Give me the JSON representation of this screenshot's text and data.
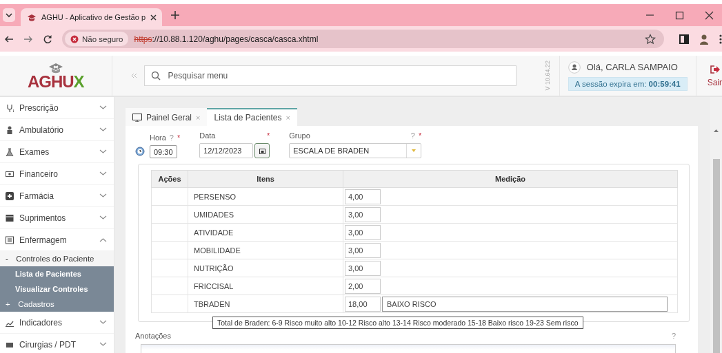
{
  "browser": {
    "tab_title": "AGHU - Aplicativo de Gestão p",
    "security_label": "Não seguro",
    "url_scheme": "https",
    "url_rest": "://10.88.1.120/aghu/pages/casca/casca.xhtml"
  },
  "header": {
    "logo_main": "AGHU",
    "logo_accent": "X",
    "search": {
      "placeholder": "Pesquisar menu"
    },
    "version": "V 10.64.22",
    "greeting": "Olá, CARLA SAMPAIO",
    "session_label": "A sessão expira em:",
    "session_time": "00:59:41",
    "logout": "Sair"
  },
  "sidebar": {
    "items": [
      {
        "label": "Prescrição",
        "expanded": false
      },
      {
        "label": "Ambulatório",
        "expanded": false
      },
      {
        "label": "Exames",
        "expanded": false
      },
      {
        "label": "Financeiro",
        "expanded": false
      },
      {
        "label": "Farmácia",
        "expanded": false
      },
      {
        "label": "Suprimentos",
        "expanded": false
      },
      {
        "label": "Enfermagem",
        "expanded": true,
        "children": [
          {
            "marker": "-",
            "label": "Controles do Paciente",
            "expanded": true,
            "children": [
              {
                "label": "Lista de Pacientes"
              },
              {
                "label": "Visualizar Controles"
              }
            ]
          },
          {
            "marker": "+",
            "label": "Cadastros",
            "expanded": false
          }
        ]
      },
      {
        "label": "Indicadores",
        "expanded": false
      },
      {
        "label": "Cirurgias / PDT",
        "expanded": false
      }
    ]
  },
  "tabs": [
    {
      "label": "Painel Geral",
      "close": "×",
      "selected": false
    },
    {
      "label": "Lista de Pacientes",
      "close": "×",
      "selected": true
    }
  ],
  "form": {
    "fields": [
      {
        "kind": "time",
        "label": "Hora",
        "help": "?",
        "required": "*",
        "value": "09:30"
      },
      {
        "kind": "date",
        "label": "Data",
        "required": "*",
        "value": "12/12/2023"
      },
      {
        "kind": "select",
        "label": "Grupo",
        "help": "?",
        "required": "*",
        "value": "ESCALA DE BRADEN"
      }
    ],
    "table": {
      "columns": [
        "Ações",
        "Itens",
        "Medição"
      ],
      "rows": [
        {
          "item": "PERSENSO",
          "value": "4,00"
        },
        {
          "item": "UMIDADES",
          "value": "3,00"
        },
        {
          "item": "ATIVIDADE",
          "value": "3,00"
        },
        {
          "item": "MOBILIDADE",
          "value": "3,00"
        },
        {
          "item": "NUTRIÇÃO",
          "value": "3,00"
        },
        {
          "item": "FRICCISAL",
          "value": "2,00"
        },
        {
          "item": "TBRADEN",
          "value": "18,00",
          "note": "BAIXO RISCO"
        }
      ]
    },
    "tooltip": "Total de Braden: 6-9 Risco muito alto 10-12 Risco alto 13-14 Risco moderado 15-18 Baixo risco 19-23 Sem risco",
    "notes_label": "Anotações",
    "notes_help": "?"
  }
}
